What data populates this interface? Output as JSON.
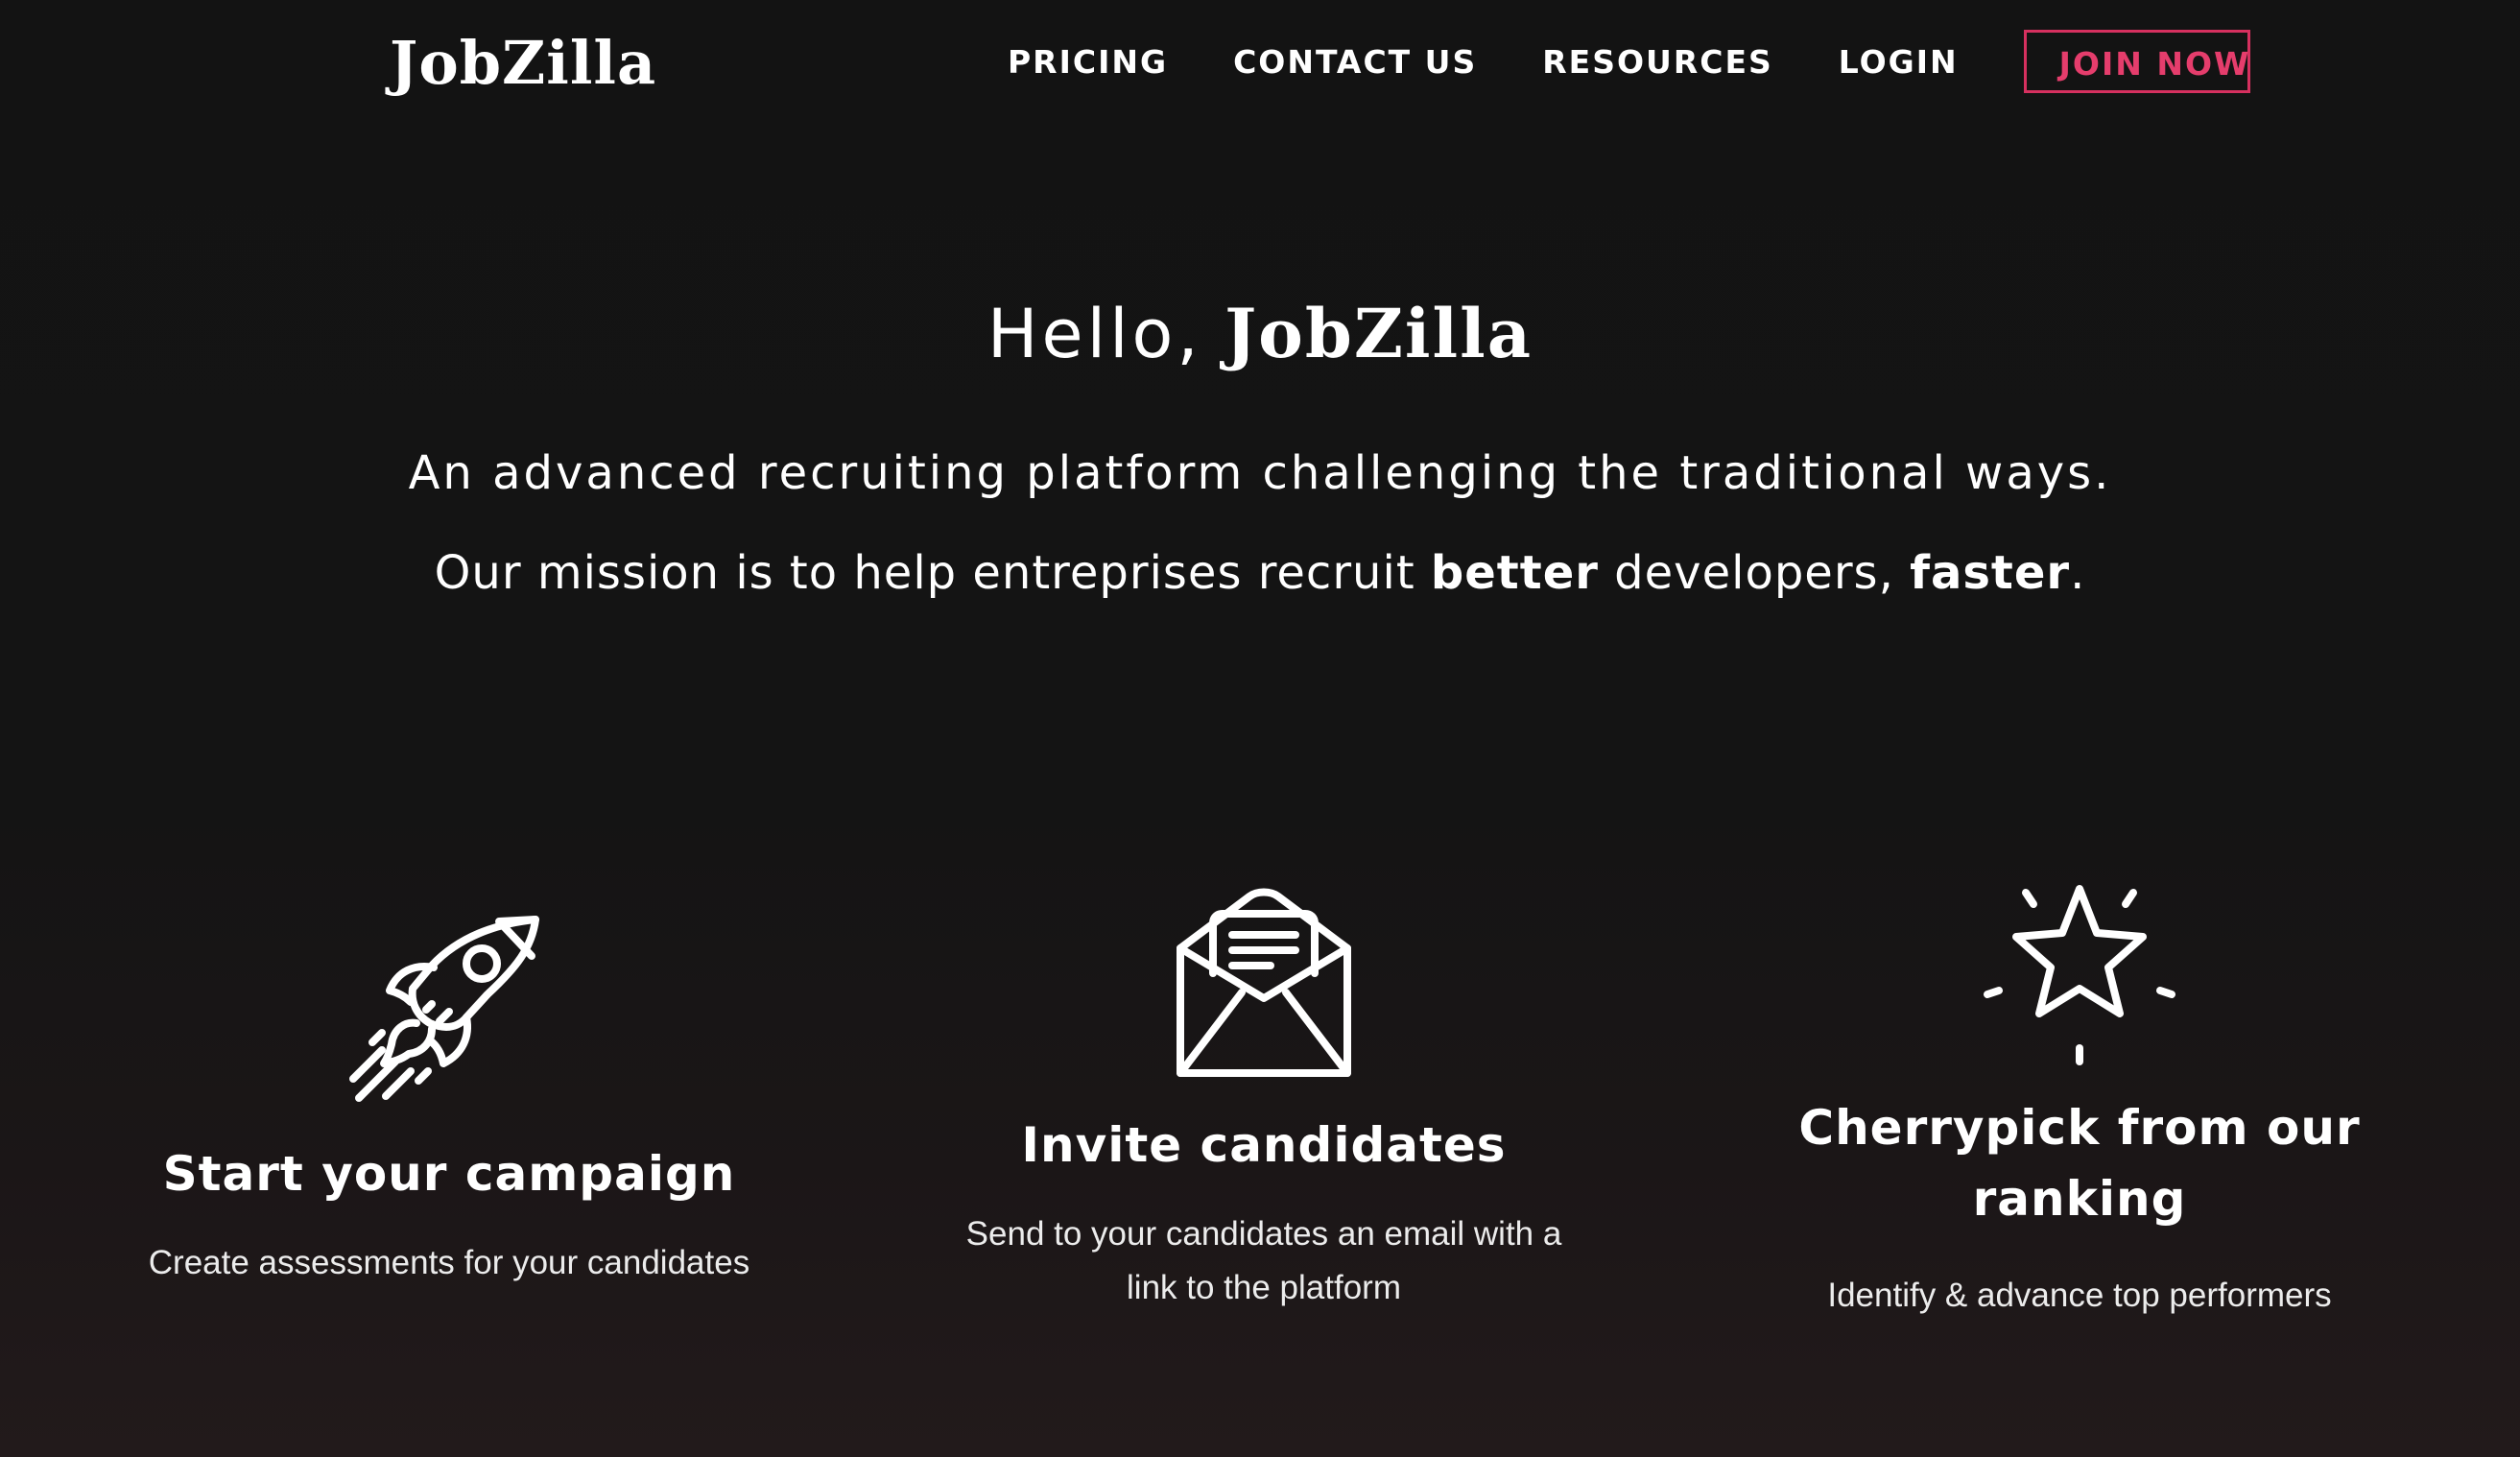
{
  "header": {
    "logo": "JobZilla",
    "nav": [
      "PRICING",
      "CONTACT US",
      "RESOURCES",
      "LOGIN"
    ],
    "join_label": "JOIN NOW"
  },
  "hero": {
    "greeting": "Hello,",
    "brand": "JobZilla",
    "tagline": "An advanced recruiting platform challenging the traditional ways.",
    "mission_prefix": "Our mission is to help entreprises recruit ",
    "mission_bold1": "better",
    "mission_middle": " developers, ",
    "mission_bold2": "faster",
    "mission_suffix": "."
  },
  "features": [
    {
      "icon": "rocket-icon",
      "title": "Start your campaign",
      "description": "Create assessments for your candidates"
    },
    {
      "icon": "envelope-icon",
      "title": "Invite candidates",
      "description_line1": "Send to your candidates an email with a",
      "description_line2": "link to the platform"
    },
    {
      "icon": "star-icon",
      "title_line1": "Cherrypick from our",
      "title_line2": "ranking",
      "description": "Identify & advance top performers"
    }
  ],
  "colors": {
    "background": "#131313",
    "accent": "#e53d6c",
    "text": "#ffffff"
  }
}
